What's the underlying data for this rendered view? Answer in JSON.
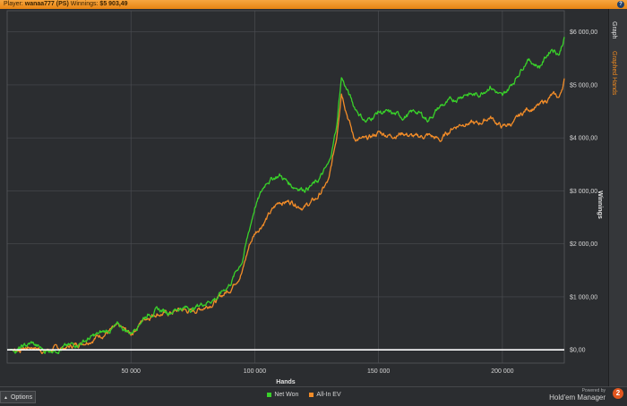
{
  "header": {
    "player_label": "Player:",
    "player_name": "wanaa777 (PS)",
    "winnings_label": "Winnings:",
    "winnings_value": "$5 903,49",
    "help_glyph": "?"
  },
  "side_tabs": {
    "graph": "Graph",
    "graphed_hands": "Graphed Hands"
  },
  "footer": {
    "options_label": "Options",
    "powered_by": "Powered by",
    "brand_name": "Hold'em Manager",
    "brand_badge": "2"
  },
  "colors": {
    "net_won": "#39d12a",
    "all_in_ev": "#f28c28",
    "zero_line": "#ffffff",
    "grid": "#4a4c50",
    "plot_bg": "#2b2d30",
    "accent": "#f28b1f"
  },
  "chart_data": {
    "type": "line",
    "xlabel": "Hands",
    "ylabel": "Winnings",
    "xlim": [
      0,
      225000
    ],
    "ylim": [
      -250,
      6400
    ],
    "xticks": [
      50000,
      100000,
      150000,
      200000
    ],
    "xtick_labels": [
      "50 000",
      "100 000",
      "150 000",
      "200 000"
    ],
    "yticks": [
      0,
      1000,
      2000,
      3000,
      4000,
      5000,
      6000
    ],
    "ytick_labels": [
      "$0,00",
      "$1 000,00",
      "$2 000,00",
      "$3 000,00",
      "$4 000,00",
      "$5 000,00",
      "$6 000,00"
    ],
    "grid": true,
    "legend_position": "bottom-center",
    "series": [
      {
        "name": "Net Won",
        "x": [
          0,
          5000,
          10000,
          15000,
          20000,
          25000,
          30000,
          35000,
          40000,
          45000,
          50000,
          55000,
          60000,
          65000,
          70000,
          75000,
          80000,
          85000,
          90000,
          95000,
          98000,
          100000,
          105000,
          110000,
          115000,
          120000,
          125000,
          130000,
          133000,
          135000,
          140000,
          145000,
          150000,
          155000,
          160000,
          165000,
          170000,
          175000,
          180000,
          185000,
          190000,
          195000,
          200000,
          205000,
          210000,
          215000,
          220000,
          223000,
          225000
        ],
        "values": [
          0,
          20,
          120,
          -20,
          30,
          60,
          150,
          250,
          350,
          450,
          320,
          620,
          750,
          720,
          800,
          780,
          900,
          1000,
          1250,
          1700,
          2300,
          2700,
          3200,
          3300,
          3100,
          3050,
          3150,
          3500,
          4200,
          5150,
          4600,
          4300,
          4500,
          4450,
          4400,
          4500,
          4350,
          4600,
          4700,
          4850,
          4800,
          5000,
          4750,
          5100,
          5500,
          5350,
          5700,
          5600,
          5900
        ]
      },
      {
        "name": "All-In EV",
        "x": [
          0,
          5000,
          10000,
          15000,
          20000,
          25000,
          30000,
          35000,
          40000,
          45000,
          50000,
          55000,
          60000,
          65000,
          70000,
          75000,
          80000,
          85000,
          90000,
          95000,
          98000,
          100000,
          105000,
          110000,
          115000,
          120000,
          125000,
          130000,
          133000,
          135000,
          140000,
          145000,
          150000,
          155000,
          160000,
          165000,
          170000,
          175000,
          180000,
          185000,
          190000,
          195000,
          200000,
          205000,
          210000,
          215000,
          220000,
          223000,
          225000
        ],
        "values": [
          0,
          10,
          60,
          -10,
          20,
          50,
          140,
          230,
          330,
          420,
          300,
          580,
          700,
          680,
          760,
          720,
          820,
          950,
          1150,
          1500,
          2000,
          2200,
          2500,
          2800,
          2800,
          2700,
          2850,
          3200,
          4000,
          4900,
          4000,
          3950,
          4100,
          4050,
          4100,
          4000,
          4050,
          3950,
          4200,
          4300,
          4250,
          4400,
          4200,
          4300,
          4550,
          4600,
          4800,
          4750,
          5100
        ]
      }
    ]
  }
}
